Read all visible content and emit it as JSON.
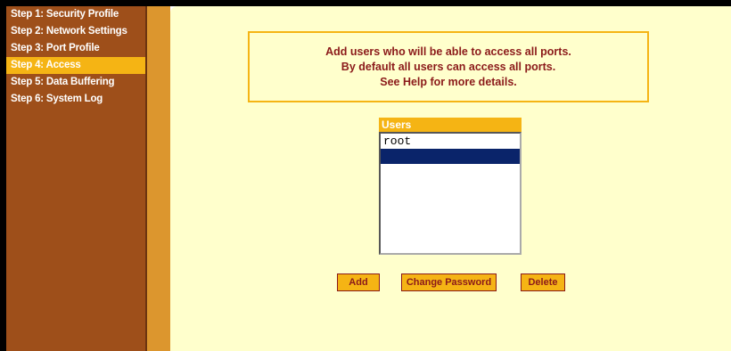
{
  "sidebar": {
    "items": [
      {
        "label": "Step 1: Security Profile"
      },
      {
        "label": "Step 2: Network Settings"
      },
      {
        "label": "Step 3: Port Profile"
      },
      {
        "label": "Step 4: Access"
      },
      {
        "label": "Step 5: Data Buffering"
      },
      {
        "label": "Step 6: System Log"
      }
    ]
  },
  "info": {
    "line1": "Add users who will be able to access all ports.",
    "line2": "By default all users can access all ports.",
    "line3": "See Help for more details."
  },
  "users": {
    "header": "Users",
    "rows": [
      {
        "name": "root"
      },
      {
        "name": ""
      }
    ]
  },
  "buttons": {
    "add": "Add",
    "change_password": "Change Password",
    "delete": "Delete"
  },
  "colors": {
    "sidebar": "#9e4f1a",
    "active": "#f5b414",
    "separator": "#dc962e",
    "main": "#ffffcc",
    "text_dark_red": "#8b1a1a",
    "selection": "#0a246a"
  }
}
